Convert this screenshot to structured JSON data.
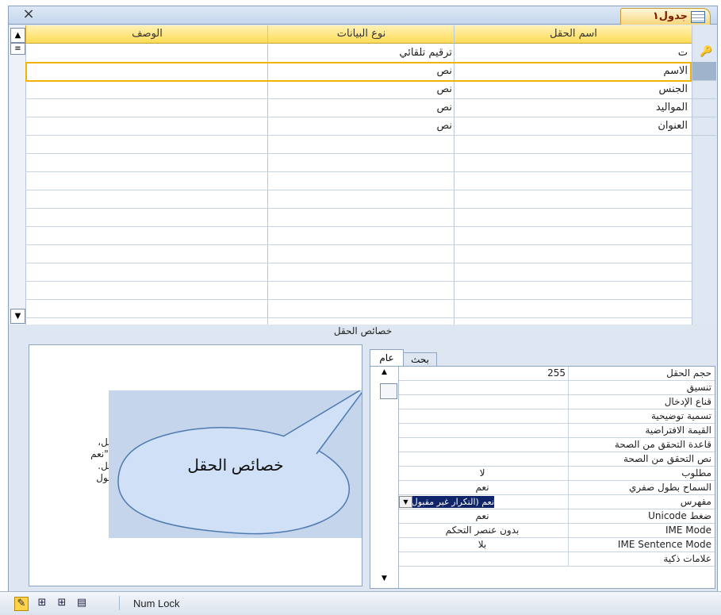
{
  "window": {
    "tab_title": "جدول١",
    "close_glyph": "×"
  },
  "grid": {
    "headers": {
      "field_name": "اسم الحقل",
      "data_type": "نوع البيانات",
      "description": "الوصف"
    },
    "rows": [
      {
        "field": "ت",
        "type": "ترقيم تلقائي",
        "desc": ""
      },
      {
        "field": "الاسم",
        "type": "نص",
        "desc": ""
      },
      {
        "field": "الجنس",
        "type": "نص",
        "desc": ""
      },
      {
        "field": "المواليد",
        "type": "نص",
        "desc": ""
      },
      {
        "field": "العنوان",
        "type": "نص",
        "desc": ""
      }
    ]
  },
  "properties": {
    "section_title": "خصائص الحقل",
    "tabs": {
      "general": "عام",
      "lookup": "بحث"
    },
    "items": [
      {
        "label": "حجم الحقل",
        "value": "255"
      },
      {
        "label": "تنسيق",
        "value": ""
      },
      {
        "label": "قناع الإدخال",
        "value": ""
      },
      {
        "label": "تسمية توضيحية",
        "value": ""
      },
      {
        "label": "القيمة الافتراضية",
        "value": ""
      },
      {
        "label": "قاعدة التحقق من الصحة",
        "value": ""
      },
      {
        "label": "نص التحقق من الصحة",
        "value": ""
      },
      {
        "label": "مطلوب",
        "value": "لا"
      },
      {
        "label": "السماح بطول صفري",
        "value": "نعم"
      },
      {
        "label": "مفهرس",
        "value": "نعم (التكرار غير مقبول)"
      },
      {
        "label": "ضغط Unicode",
        "value": "نعم"
      },
      {
        "label": "IME Mode",
        "value": "بدون عنصر التحكم"
      },
      {
        "label": "IME Sentence Mode",
        "value": "بلا"
      },
      {
        "label": "علامات ذكية",
        "value": ""
      }
    ],
    "help_lines": [
      "الحقل،",
      "نيار \"نعم",
      "الحقل.",
      "الحقول"
    ]
  },
  "callout": {
    "text": "خصائص الحقل"
  },
  "statusbar": {
    "num_lock": "Num Lock"
  },
  "colors": {
    "header_yellow": "#ffdc55",
    "highlight_border": "#f0b400",
    "callout_fill": "#cfe0f7"
  }
}
